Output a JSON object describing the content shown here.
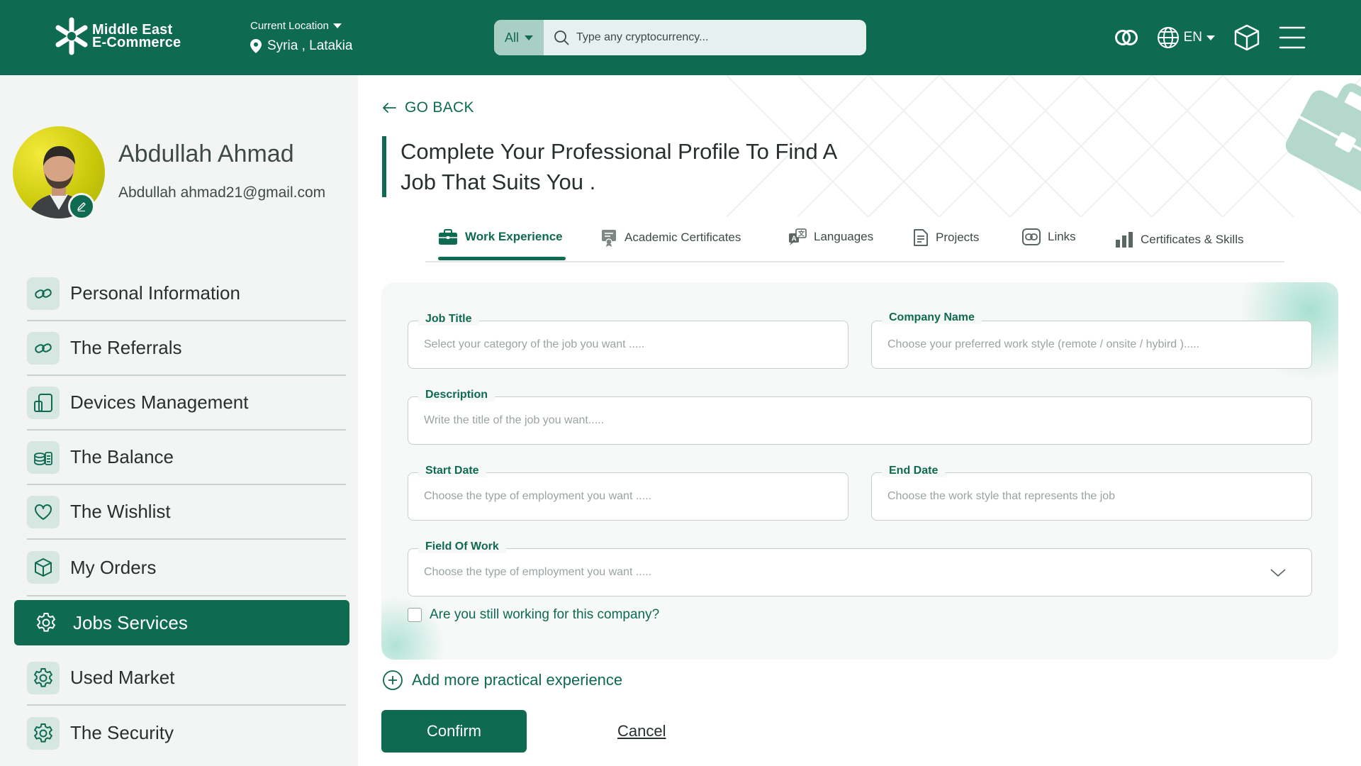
{
  "header": {
    "brand_line1": "Middle East",
    "brand_line2": "E-Commerce",
    "location_label": "Current Location",
    "location_value": "Syria , Latakia",
    "search_category": "All",
    "search_placeholder": "Type any cryptocurrency...",
    "language": "EN",
    "icons": [
      "coins-icon",
      "globe-icon",
      "box-icon",
      "menu-icon"
    ]
  },
  "profile": {
    "name": "Abdullah Ahmad",
    "email": "Abdullah ahmad21@gmail.com"
  },
  "sidebar": {
    "items": [
      {
        "label": "Personal Information",
        "icon": "link-icon"
      },
      {
        "label": "The Referrals",
        "icon": "link-icon"
      },
      {
        "label": "Devices Management",
        "icon": "devices-icon"
      },
      {
        "label": "The Balance",
        "icon": "coins-stack-icon"
      },
      {
        "label": "The Wishlist",
        "icon": "heart-icon"
      },
      {
        "label": "My Orders",
        "icon": "box-icon"
      },
      {
        "label": "Jobs Services",
        "icon": "gear-icon",
        "active": true
      },
      {
        "label": "Used Market",
        "icon": "gear-icon"
      },
      {
        "label": "The Security",
        "icon": "gear-icon"
      }
    ]
  },
  "main": {
    "go_back": "GO BACK",
    "title_line1": "Complete Your Professional Profile To Find A",
    "title_line2": "Job That Suits You .",
    "tabs": [
      {
        "label": "Work Experience",
        "icon": "briefcase-icon",
        "active": true
      },
      {
        "label": "Academic Certificates",
        "icon": "certificate-icon"
      },
      {
        "label": "Languages",
        "icon": "translate-icon"
      },
      {
        "label": "Projects",
        "icon": "document-icon"
      },
      {
        "label": "Links",
        "icon": "link-icon"
      },
      {
        "label": "Certificates & Skills",
        "icon": "bar-chart-icon"
      }
    ],
    "form": {
      "job_title": {
        "label": "Job Title",
        "placeholder": "Select your category of the job you want ....."
      },
      "company_name": {
        "label": "Company Name",
        "placeholder": "Choose your preferred work style (remote / onsite / hybird )....."
      },
      "description": {
        "label": "Description",
        "placeholder": "Write the title of the job you want....."
      },
      "start_date": {
        "label": "Start Date",
        "placeholder": "Choose the type of employment you want ....."
      },
      "end_date": {
        "label": "End Date",
        "placeholder": "Choose the work style that represents the job"
      },
      "field_of_work": {
        "label": "Field Of Work",
        "placeholder": "Choose the type of employment you want ....."
      },
      "still_working": "Are you still working for this company?"
    },
    "add_more": "Add more practical experience",
    "confirm": "Confirm",
    "cancel": "Cancel"
  },
  "colors": {
    "primary": "#0e6a50",
    "sidebar_bg": "#f3f5f4",
    "icon_tile": "#d6e7e1"
  }
}
